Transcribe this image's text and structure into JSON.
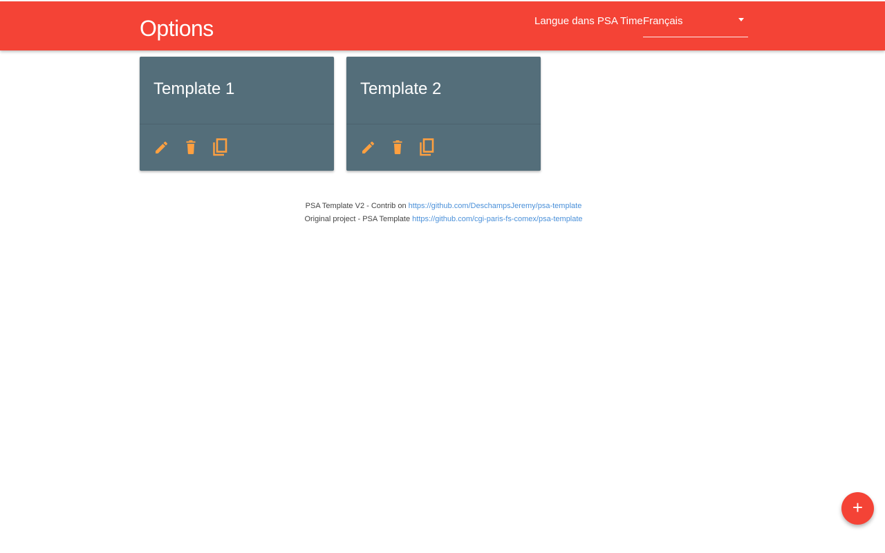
{
  "header": {
    "title": "Options",
    "language_label": "Langue dans PSA Time",
    "language_select": {
      "selected": "Français"
    }
  },
  "templates": [
    {
      "title": "Template 1",
      "actions": [
        "edit-icon",
        "delete-icon",
        "copy-icon"
      ]
    },
    {
      "title": "Template 2",
      "actions": [
        "edit-icon",
        "delete-icon",
        "copy-icon"
      ]
    }
  ],
  "footer": {
    "line1_text": "PSA Template V2 - Contrib on",
    "line1_link": "https://github.com/DeschampsJeremy/psa-template",
    "line2_text": "Original project - PSA Template",
    "line2_link": "https://github.com/cgi-paris-fs-comex/psa-template"
  },
  "fab": {
    "icon": "plus-icon",
    "label": "+"
  },
  "colors": {
    "header": "#f44336",
    "card": "#546e7a",
    "action_icons": "#ffa040",
    "link": "#4a90d9",
    "fab": "#f44336"
  }
}
